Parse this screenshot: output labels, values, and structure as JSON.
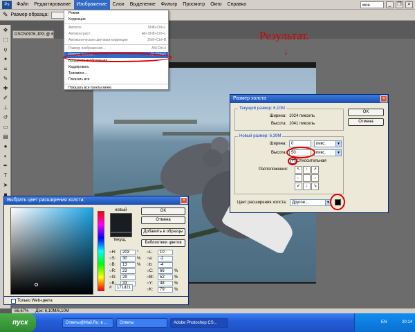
{
  "menubar": {
    "logo": "Ps",
    "items": [
      "Файл",
      "Редактирование",
      "Изображение",
      "Слои",
      "Выделение",
      "Фильтр",
      "Просмотр",
      "Окно",
      "Справка"
    ],
    "workspace": "мое"
  },
  "optionsbar": {
    "sample_label": "Размер образца:"
  },
  "doc_tab": "DSCN0976.JPG @ 66,7%",
  "annotation": "Результат.",
  "image_menu": {
    "items": [
      {
        "label": "Режим",
        "shortcut": ""
      },
      {
        "label": "Коррекция",
        "shortcut": ""
      },
      {
        "sep": true
      },
      {
        "label": "Автотон",
        "shortcut": "Shift+Ctrl+L"
      },
      {
        "label": "Автоконтраст",
        "shortcut": "Alt+Shift+Ctrl+L"
      },
      {
        "label": "Автоматическая цветовая коррекция",
        "shortcut": "Shift+Ctrl+B"
      },
      {
        "sep": true
      },
      {
        "label": "Размер изображения...",
        "shortcut": "Alt+Ctrl+I"
      },
      {
        "label": "Размер холста...",
        "shortcut": "Alt+Ctrl+C"
      },
      {
        "label": "Вращение изображения",
        "shortcut": ""
      },
      {
        "label": "Кадрировать",
        "shortcut": ""
      },
      {
        "label": "Тримминг...",
        "shortcut": ""
      },
      {
        "label": "Показать все",
        "shortcut": ""
      },
      {
        "sep": true
      },
      {
        "label": "Показать все пункты меню",
        "shortcut": ""
      }
    ]
  },
  "canvas_dialog": {
    "title": "Размер холста",
    "current_legend": "Текущий размер: 6,10M",
    "current_width_label": "Ширина:",
    "current_width_value": "1024 пиксель",
    "current_height_label": "Высота:",
    "current_height_value": "1041 пиксель",
    "new_legend": "Новый размер: 6,39M",
    "width_label": "Ширина:",
    "width_value": "0",
    "height_label": "Высота:",
    "height_value": "50",
    "unit": "пикс.",
    "relative_label": "Относительная",
    "anchor_label": "Расположение:",
    "anchor_arrows": [
      "↖",
      "↑",
      "↗",
      "←",
      "",
      "→",
      "↙",
      "↓",
      "↘"
    ],
    "ext_color_label": "Цвет расширения холста:",
    "ext_color_value": "Другое...",
    "ok": "OK",
    "cancel": "Отмена"
  },
  "picker_dialog": {
    "title": "Выбрать цвет расширения холста:",
    "new_label": "новый",
    "current_label": "текущ.",
    "ok": "OK",
    "cancel": "Отмена",
    "add_swatches": "Добавить в образцы",
    "libraries": "Библиотеки цветов",
    "fields": {
      "H": "203",
      "S": "30",
      "B": "13",
      "R": "23",
      "G": "29",
      "Bb": "33",
      "L": "10",
      "a": "-2",
      "b": "-4",
      "C": "66",
      "M": "52",
      "Y": "48",
      "K": "79"
    },
    "units": {
      "deg": "°",
      "pct": "%"
    },
    "hex_label": "#",
    "hex": "171d21",
    "web_only": "Только Web-цвета"
  },
  "statusbar": {
    "zoom": "66,67%",
    "doc": "Док: 6,10M/6,10M"
  },
  "taskbar": {
    "start": "пуск",
    "tasks": [
      "Ответы@Mail.Ru: в ...",
      "Ответы",
      "Adobe Photoshop CS..."
    ],
    "lang": "EN",
    "time": "20:14"
  },
  "colors": {
    "accent": "#316ac5",
    "annotation_red": "#d40000",
    "new_color": "#171d21",
    "current_color": "#171d21"
  }
}
